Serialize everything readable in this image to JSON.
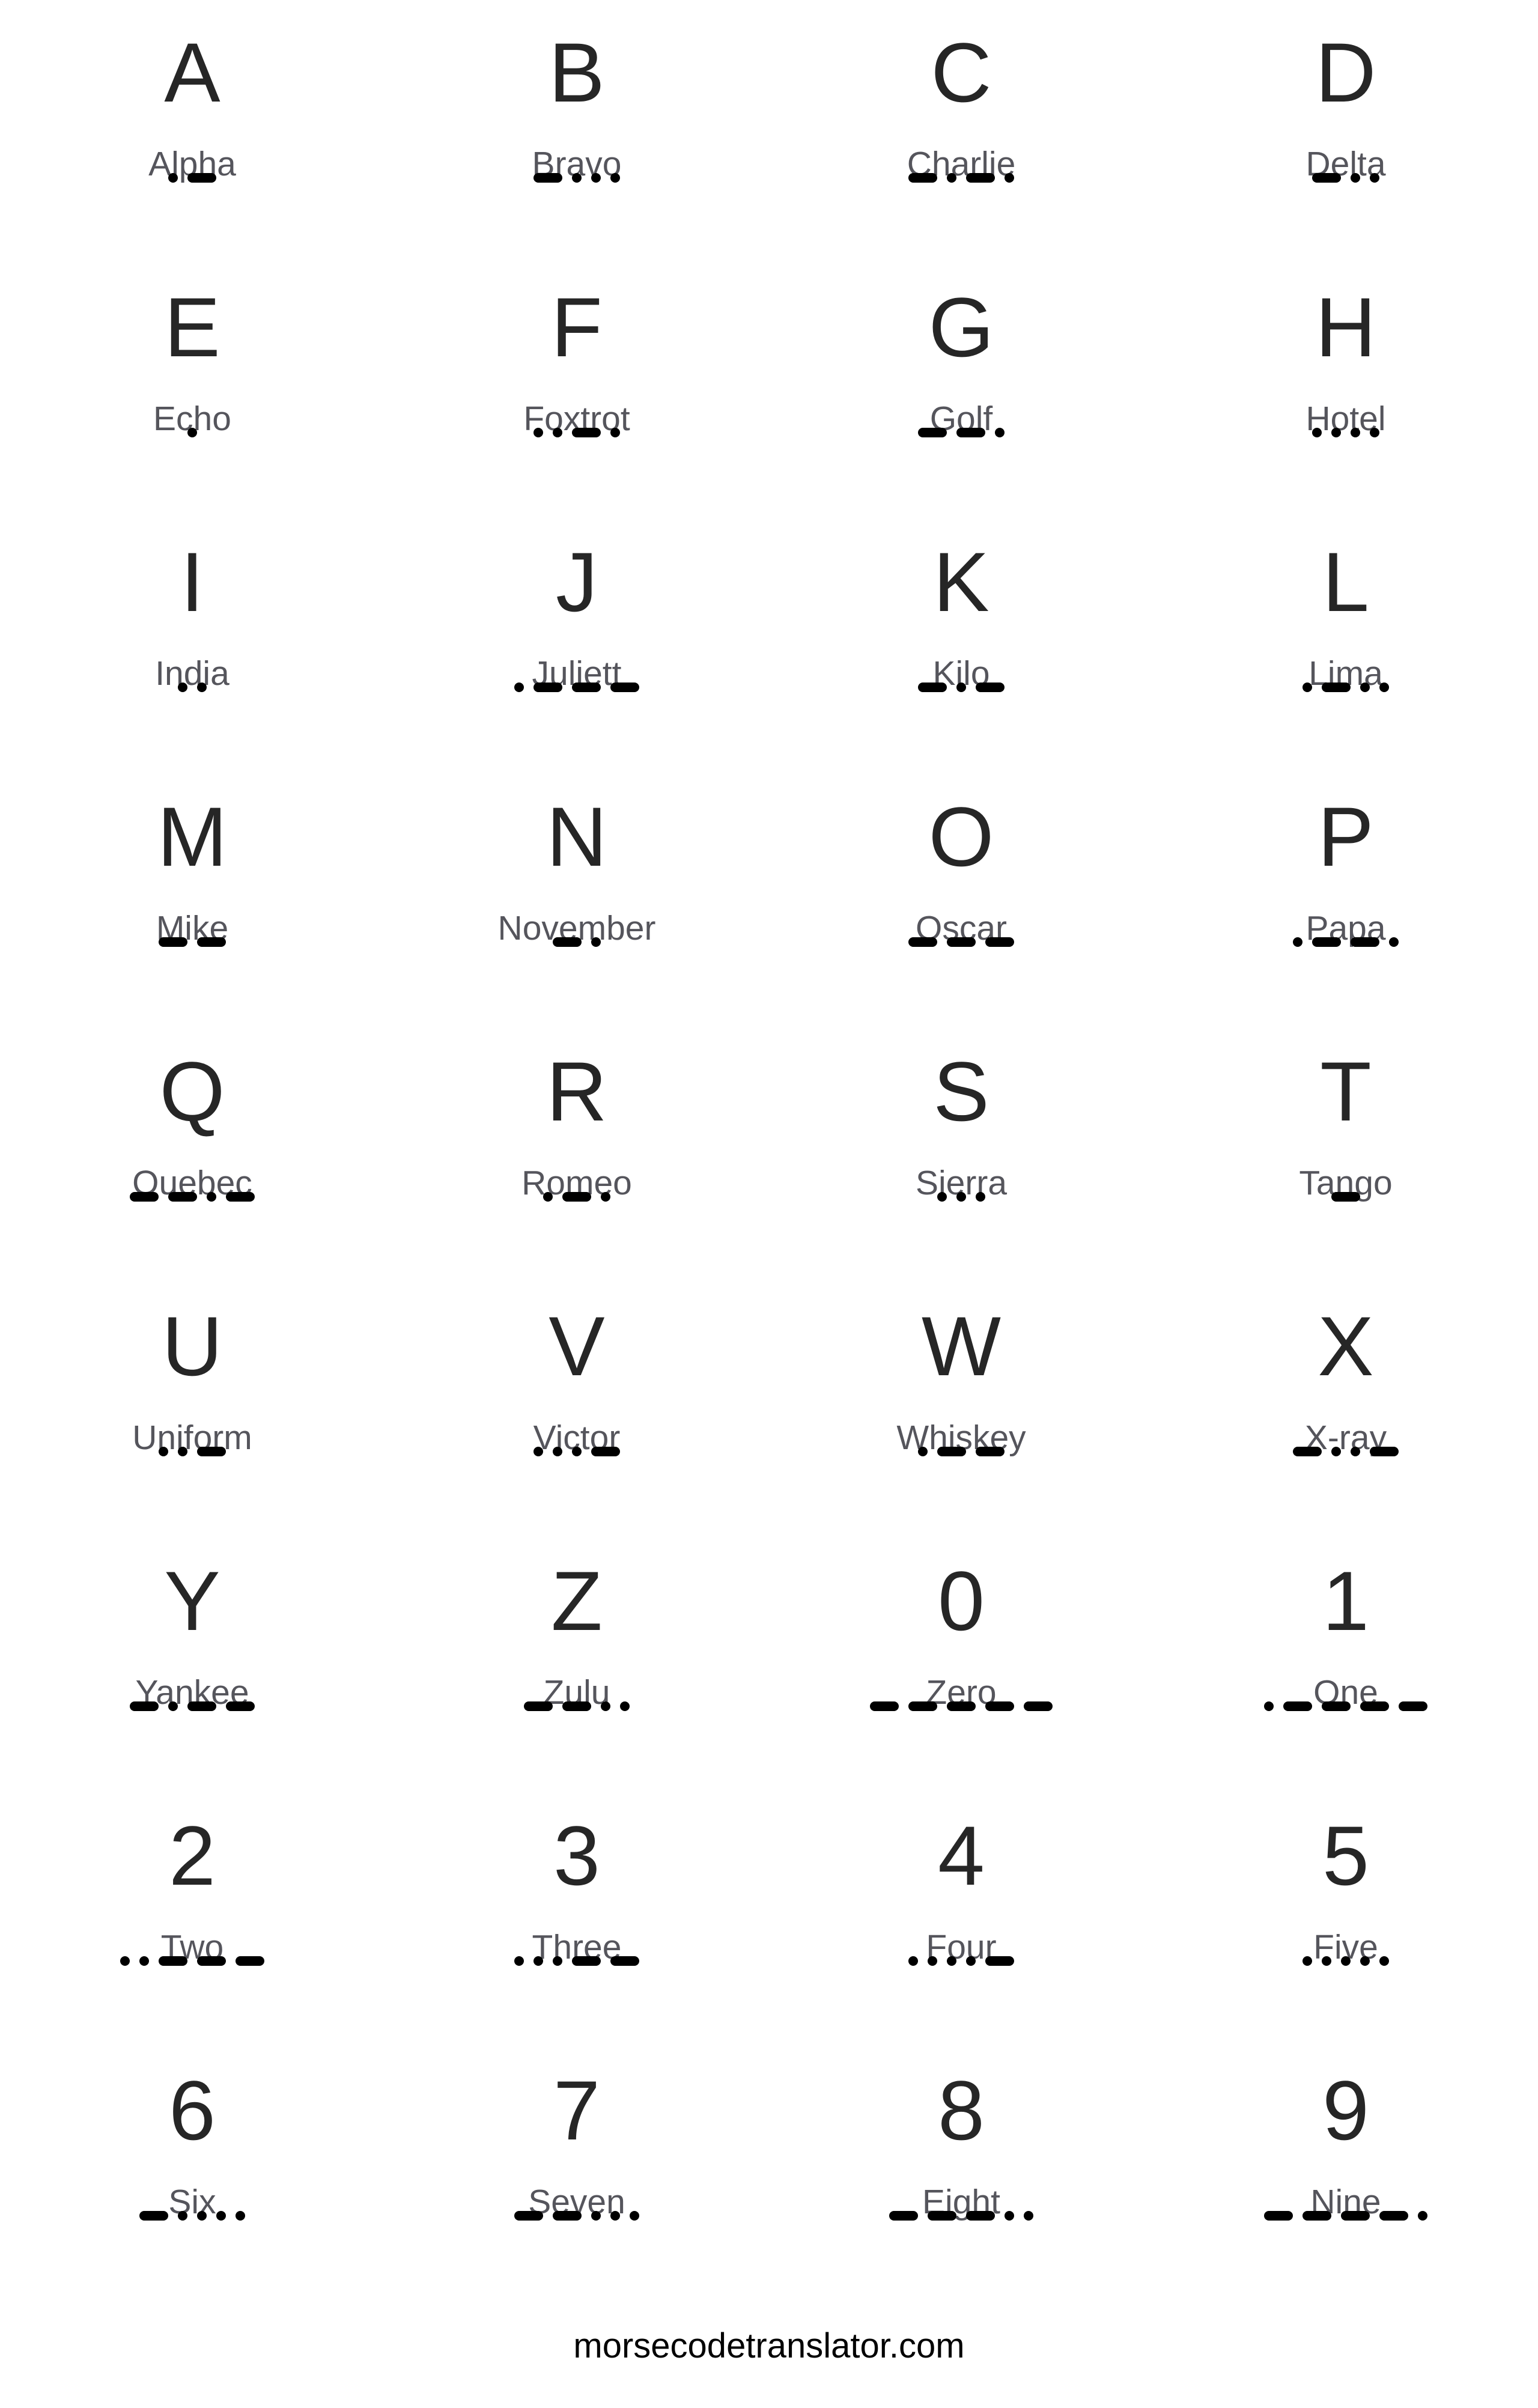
{
  "chart": {
    "entries": [
      {
        "char": "A",
        "word": "Alpha",
        "code": ".-"
      },
      {
        "char": "B",
        "word": "Bravo",
        "code": "-..."
      },
      {
        "char": "C",
        "word": "Charlie",
        "code": "-.-."
      },
      {
        "char": "D",
        "word": "Delta",
        "code": "-.."
      },
      {
        "char": "E",
        "word": "Echo",
        "code": "."
      },
      {
        "char": "F",
        "word": "Foxtrot",
        "code": "..-."
      },
      {
        "char": "G",
        "word": "Golf",
        "code": "--."
      },
      {
        "char": "H",
        "word": "Hotel",
        "code": "...."
      },
      {
        "char": "I",
        "word": "India",
        "code": ".."
      },
      {
        "char": "J",
        "word": "Juliett",
        "code": ".---"
      },
      {
        "char": "K",
        "word": "Kilo",
        "code": "-.-"
      },
      {
        "char": "L",
        "word": "Lima",
        "code": ".-.."
      },
      {
        "char": "M",
        "word": "Mike",
        "code": "--"
      },
      {
        "char": "N",
        "word": "November",
        "code": "-."
      },
      {
        "char": "O",
        "word": "Oscar",
        "code": "---"
      },
      {
        "char": "P",
        "word": "Papa",
        "code": ".--."
      },
      {
        "char": "Q",
        "word": "Quebec",
        "code": "--.-"
      },
      {
        "char": "R",
        "word": "Romeo",
        "code": ".-."
      },
      {
        "char": "S",
        "word": "Sierra",
        "code": "..."
      },
      {
        "char": "T",
        "word": "Tango",
        "code": "-"
      },
      {
        "char": "U",
        "word": "Uniform",
        "code": "..-"
      },
      {
        "char": "V",
        "word": "Victor",
        "code": "...-"
      },
      {
        "char": "W",
        "word": "Whiskey",
        "code": ".--"
      },
      {
        "char": "X",
        "word": "X-ray",
        "code": "-..-"
      },
      {
        "char": "Y",
        "word": "Yankee",
        "code": "-.--"
      },
      {
        "char": "Z",
        "word": "Zulu",
        "code": "--.."
      },
      {
        "char": "0",
        "word": "Zero",
        "code": "-----"
      },
      {
        "char": "1",
        "word": "One",
        "code": ".----"
      },
      {
        "char": "2",
        "word": "Two",
        "code": "..---"
      },
      {
        "char": "3",
        "word": "Three",
        "code": "...--"
      },
      {
        "char": "4",
        "word": "Four",
        "code": "....-"
      },
      {
        "char": "5",
        "word": "Five",
        "code": "....."
      },
      {
        "char": "6",
        "word": "Six",
        "code": "-...."
      },
      {
        "char": "7",
        "word": "Seven",
        "code": "--..."
      },
      {
        "char": "8",
        "word": "Eight",
        "code": "---.."
      },
      {
        "char": "9",
        "word": "Nine",
        "code": "----."
      }
    ]
  },
  "footer": {
    "site": "morsecodetranslator.com"
  },
  "colors": {
    "glyph": "#262626",
    "word": "#55555c",
    "symbol": "#000000",
    "background": "#ffffff"
  }
}
